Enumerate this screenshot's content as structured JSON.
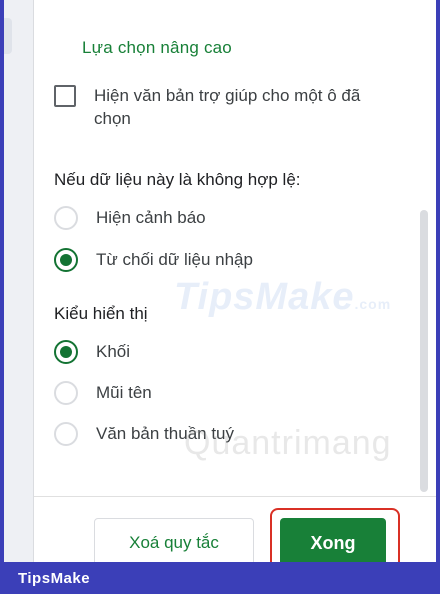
{
  "dialog": {
    "section_title": "Lựa chọn nâng cao",
    "helptext_option": {
      "label": "Hiện văn bản trợ giúp cho một ô đã chọn",
      "checked": false
    },
    "invalid_group": {
      "label": "Nếu dữ liệu này là không hợp lệ:",
      "options": [
        {
          "label": "Hiện cảnh báo",
          "selected": false
        },
        {
          "label": "Từ chối dữ liệu nhập",
          "selected": true
        }
      ]
    },
    "style_group": {
      "label": "Kiểu hiển thị",
      "options": [
        {
          "label": "Khối",
          "selected": true
        },
        {
          "label": "Mũi tên",
          "selected": false
        },
        {
          "label": "Văn bản thuần tuý",
          "selected": false
        }
      ]
    },
    "buttons": {
      "clear_label": "Xoá quy tắc",
      "done_label": "Xong"
    }
  },
  "watermarks": {
    "tipsmake": "TipsMake",
    "tipsmake_suffix": ".com",
    "quantrimang": "Quantrimang"
  },
  "branding": {
    "footer_label": "TipsMake"
  },
  "colors": {
    "accent_green": "#188038",
    "radio_green": "#137333",
    "highlight_red": "#d93025",
    "brand_blue": "#3b3fb8"
  }
}
